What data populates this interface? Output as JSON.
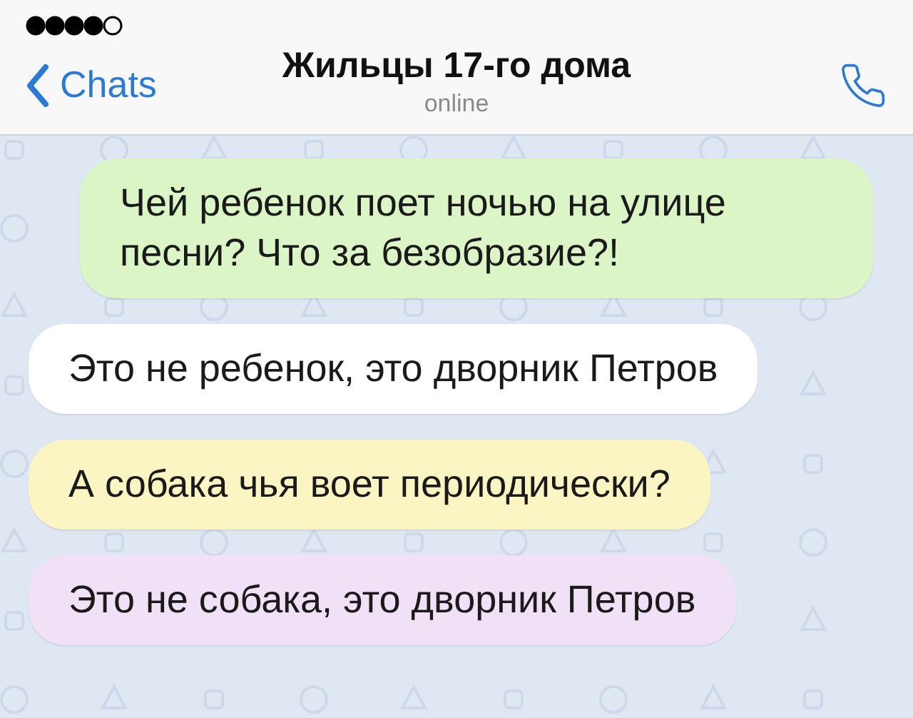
{
  "header": {
    "back_label": "Chats",
    "title": "Жильцы 17-го дома",
    "status": "online"
  },
  "messages": [
    {
      "outgoing": true,
      "color": "#dcf5c6",
      "text": "Чей ребенок поет ночью на улице песни? Что за безобразие?!"
    },
    {
      "outgoing": false,
      "color": "#ffffff",
      "text": "Это не ребенок, это дворник Петров"
    },
    {
      "outgoing": false,
      "color": "#fbf5c4",
      "text": "А собака чья воет периодически?"
    },
    {
      "outgoing": false,
      "color": "#f1e1f7",
      "text": "Это не собака, это дворник Петров"
    }
  ]
}
